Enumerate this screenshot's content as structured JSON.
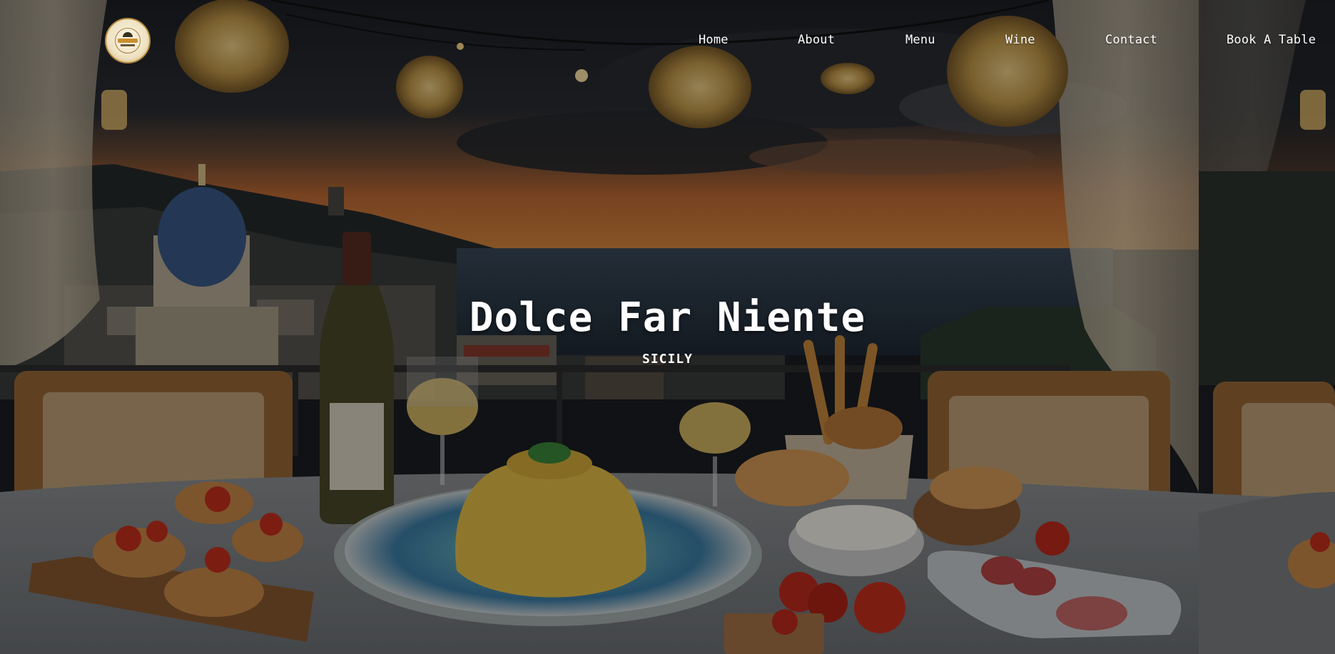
{
  "nav": {
    "logo_alt": "Dolce Far Niente logo",
    "items": [
      {
        "label": "Home"
      },
      {
        "label": "About"
      },
      {
        "label": "Menu"
      },
      {
        "label": "Wine"
      },
      {
        "label": "Contact"
      },
      {
        "label": "Book A Table"
      }
    ]
  },
  "hero": {
    "title": "Dolce Far Niente",
    "subtitle": "SICILY",
    "background_description_icon": "sicilian-terrace-dinner-image"
  },
  "colors": {
    "text": "#ffffff",
    "sky_dark": "#23262c",
    "sunset": "#e48a3a",
    "sea": "#2b3a4a",
    "tablecloth": "#9ea0a2",
    "wood": "#a8713a"
  }
}
